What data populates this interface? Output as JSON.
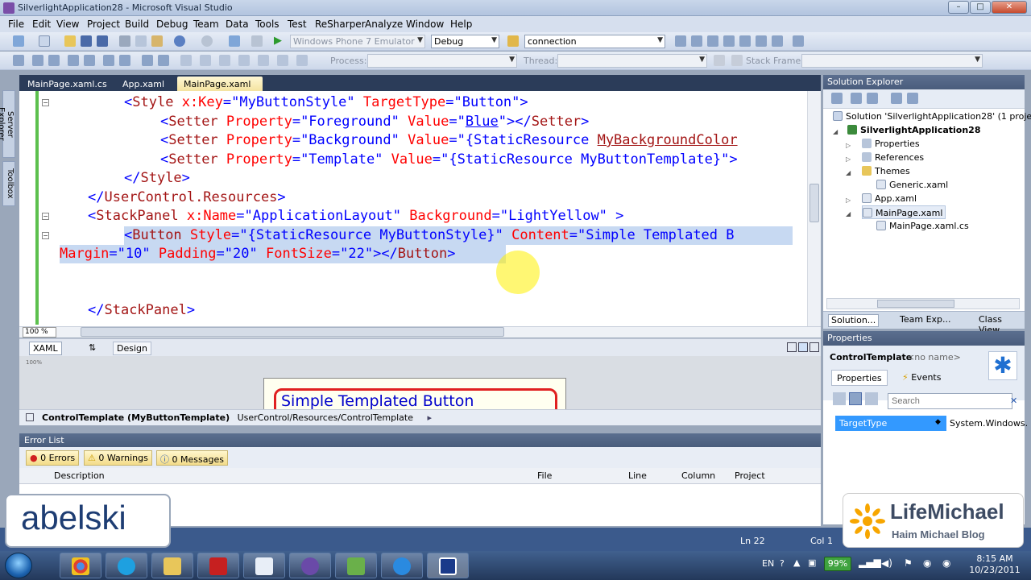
{
  "window": {
    "title": "SilverlightApplication28 - Microsoft Visual Studio",
    "minimize": "–",
    "maximize": "□",
    "close": "✕"
  },
  "menu": [
    "File",
    "Edit",
    "View",
    "Project",
    "Build",
    "Debug",
    "Team",
    "Data",
    "Tools",
    "Test",
    "ReSharper",
    "Analyze",
    "Window",
    "Help"
  ],
  "toolbar": {
    "target_combo": "Windows Phone 7 Emulator",
    "config_combo": "Debug",
    "find_combo": "connection",
    "process_label": "Process:",
    "thread_label": "Thread:",
    "stackframe_label": "Stack Frame:"
  },
  "left_tabs": {
    "server_explorer": "Server Explorer",
    "toolbox": "Toolbox"
  },
  "doc_tabs": [
    {
      "label": "MainPage.xaml.cs"
    },
    {
      "label": "App.xaml"
    },
    {
      "label": "MainPage.xaml",
      "close": "✕"
    }
  ],
  "code": {
    "l1": {
      "a": "<",
      "tag": "Style",
      "sp1": " ",
      "attr1": "x:Key",
      "eq1": "=",
      "v1": "\"MyButtonStyle\"",
      "sp2": " ",
      "attr2": "TargetType",
      "eq2": "=",
      "v2": "\"Button\"",
      "end": ">"
    },
    "l2": {
      "a": "<",
      "tag": "Setter",
      "sp1": " ",
      "attr1": "Property",
      "eq1": "=",
      "v1": "\"Foreground\"",
      "sp2": " ",
      "attr2": "Value",
      "eq2": "=",
      "q1": "\"",
      "v2": "Blue",
      "q2": "\"",
      "end": "></",
      "tag2": "Setter",
      "close": ">"
    },
    "l3": {
      "a": "<",
      "tag": "Setter",
      "sp1": " ",
      "attr1": "Property",
      "eq1": "=",
      "v1": "\"Background\"",
      "sp2": " ",
      "attr2": "Value",
      "eq2": "=",
      "v2": "\"{StaticResource ",
      "v3": "MyBackgroundColor"
    },
    "l4": {
      "a": "<",
      "tag": "Setter",
      "sp1": " ",
      "attr1": "Property",
      "eq1": "=",
      "v1": "\"Template\"",
      "sp2": " ",
      "attr2": "Value",
      "eq2": "=",
      "v2": "\"{StaticResource MyButtonTemplate}\"",
      "end": ">"
    },
    "l5": {
      "a": "</",
      "tag": "Style",
      "end": ">"
    },
    "l6": {
      "a": "</",
      "tag": "UserControl.Resources",
      "end": ">"
    },
    "l7": {
      "a": "<",
      "tag": "StackPanel",
      "sp1": " ",
      "attr1": "x:Name",
      "eq1": "=",
      "v1": "\"ApplicationLayout\"",
      "sp2": " ",
      "attr2": "Background",
      "eq2": "=",
      "v2": "\"LightYellow\"",
      "end": " >"
    },
    "l8": {
      "a": "<",
      "tag": "Button",
      "sp1": " ",
      "attr1": "Style",
      "eq1": "=",
      "v1": "\"{StaticResource MyButtonStyle}\"",
      "sp2": " ",
      "attr2": "Content",
      "eq2": "=",
      "v2": "\"Simple Templated B"
    },
    "l9": {
      "attr1": "Margin",
      "eq1": "=",
      "v1": "\"10\"",
      "sp1": " ",
      "attr2": "Padding",
      "eq2": "=",
      "v2": "\"20\"",
      "sp2": " ",
      "attr3": "FontSize",
      "eq3": "=",
      "v3": "\"22\"",
      "end": "></",
      "tag": "Button",
      "close": ">"
    },
    "l10": {
      "a": "</",
      "tag": "StackPanel",
      "end": ">"
    }
  },
  "zoom": "100 %",
  "split": {
    "xaml_tab": "XAML",
    "swap_icon": "⇅",
    "design_tab": "Design"
  },
  "design_preview": {
    "button_text": "Simple Templated Button",
    "zoom": "100%"
  },
  "breadcrumb": {
    "item1": "ControlTemplate (MyButtonTemplate)",
    "item2": "UserControl/Resources/ControlTemplate",
    "arrow": "▸"
  },
  "error_list": {
    "title": "Error List",
    "errors": "0 Errors",
    "warnings": "0 Warnings",
    "messages": "0 Messages",
    "columns": [
      "Description",
      "File",
      "Line",
      "Column",
      "Project"
    ]
  },
  "solution_explorer": {
    "title": "Solution Explorer",
    "items": [
      "Solution 'SilverlightApplication28' (1 project",
      "SilverlightApplication28",
      "Properties",
      "References",
      "Themes",
      "Generic.xaml",
      "App.xaml",
      "MainPage.xaml",
      "MainPage.xaml.cs"
    ],
    "tabs": [
      "Solution...",
      "Team Exp...",
      "Class View"
    ]
  },
  "properties": {
    "title": "Properties",
    "object": "ControlTemplate",
    "object_name": "<no name>",
    "tab_properties": "Properties",
    "tab_events": "Events",
    "search_placeholder": "Search",
    "row_name": "TargetType",
    "row_value": "System.Windows."
  },
  "status": {
    "ln": "Ln 22",
    "col": "Col 1"
  },
  "watermarks": {
    "left": "abelski",
    "right_title": "LifeMichael",
    "right_sub": "Haim Michael Blog"
  },
  "taskbar": {
    "lang": "EN",
    "battery": "99%",
    "time": "8:15 AM",
    "date": "10/23/2011"
  }
}
